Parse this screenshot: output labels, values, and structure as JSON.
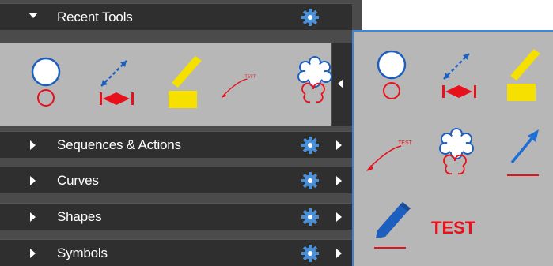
{
  "panel": {
    "sections": [
      {
        "label": "Recent Tools",
        "expanded": true
      },
      {
        "label": "Sequences & Actions",
        "expanded": false
      },
      {
        "label": "Curves",
        "expanded": false
      },
      {
        "label": "Shapes",
        "expanded": false
      },
      {
        "label": "Symbols",
        "expanded": false
      }
    ],
    "recent_tools": [
      "circle-tool-icon",
      "dimension-tool-icon",
      "highlighter-tool-icon",
      "leader-text-tool-icon",
      "cloud-tool-icon"
    ]
  },
  "flyout": {
    "tools": [
      "circle-tool-icon",
      "dimension-tool-icon",
      "highlighter-tool-icon",
      "leader-text-tool-icon",
      "cloud-tool-icon",
      "arrow-tool-icon",
      "pen-tool-icon",
      "text-tool"
    ],
    "text_tool_label": "TEST",
    "leader_text": "TEST"
  },
  "colors": {
    "panel_bg": "#4b4b4b",
    "header_bg": "#2f2f2f",
    "tools_bg": "#b7b7b7",
    "accent_blue": "#3a86d9",
    "red": "#e8101a",
    "yellow": "#f5e000",
    "gear_blue": "#4a90d9"
  }
}
